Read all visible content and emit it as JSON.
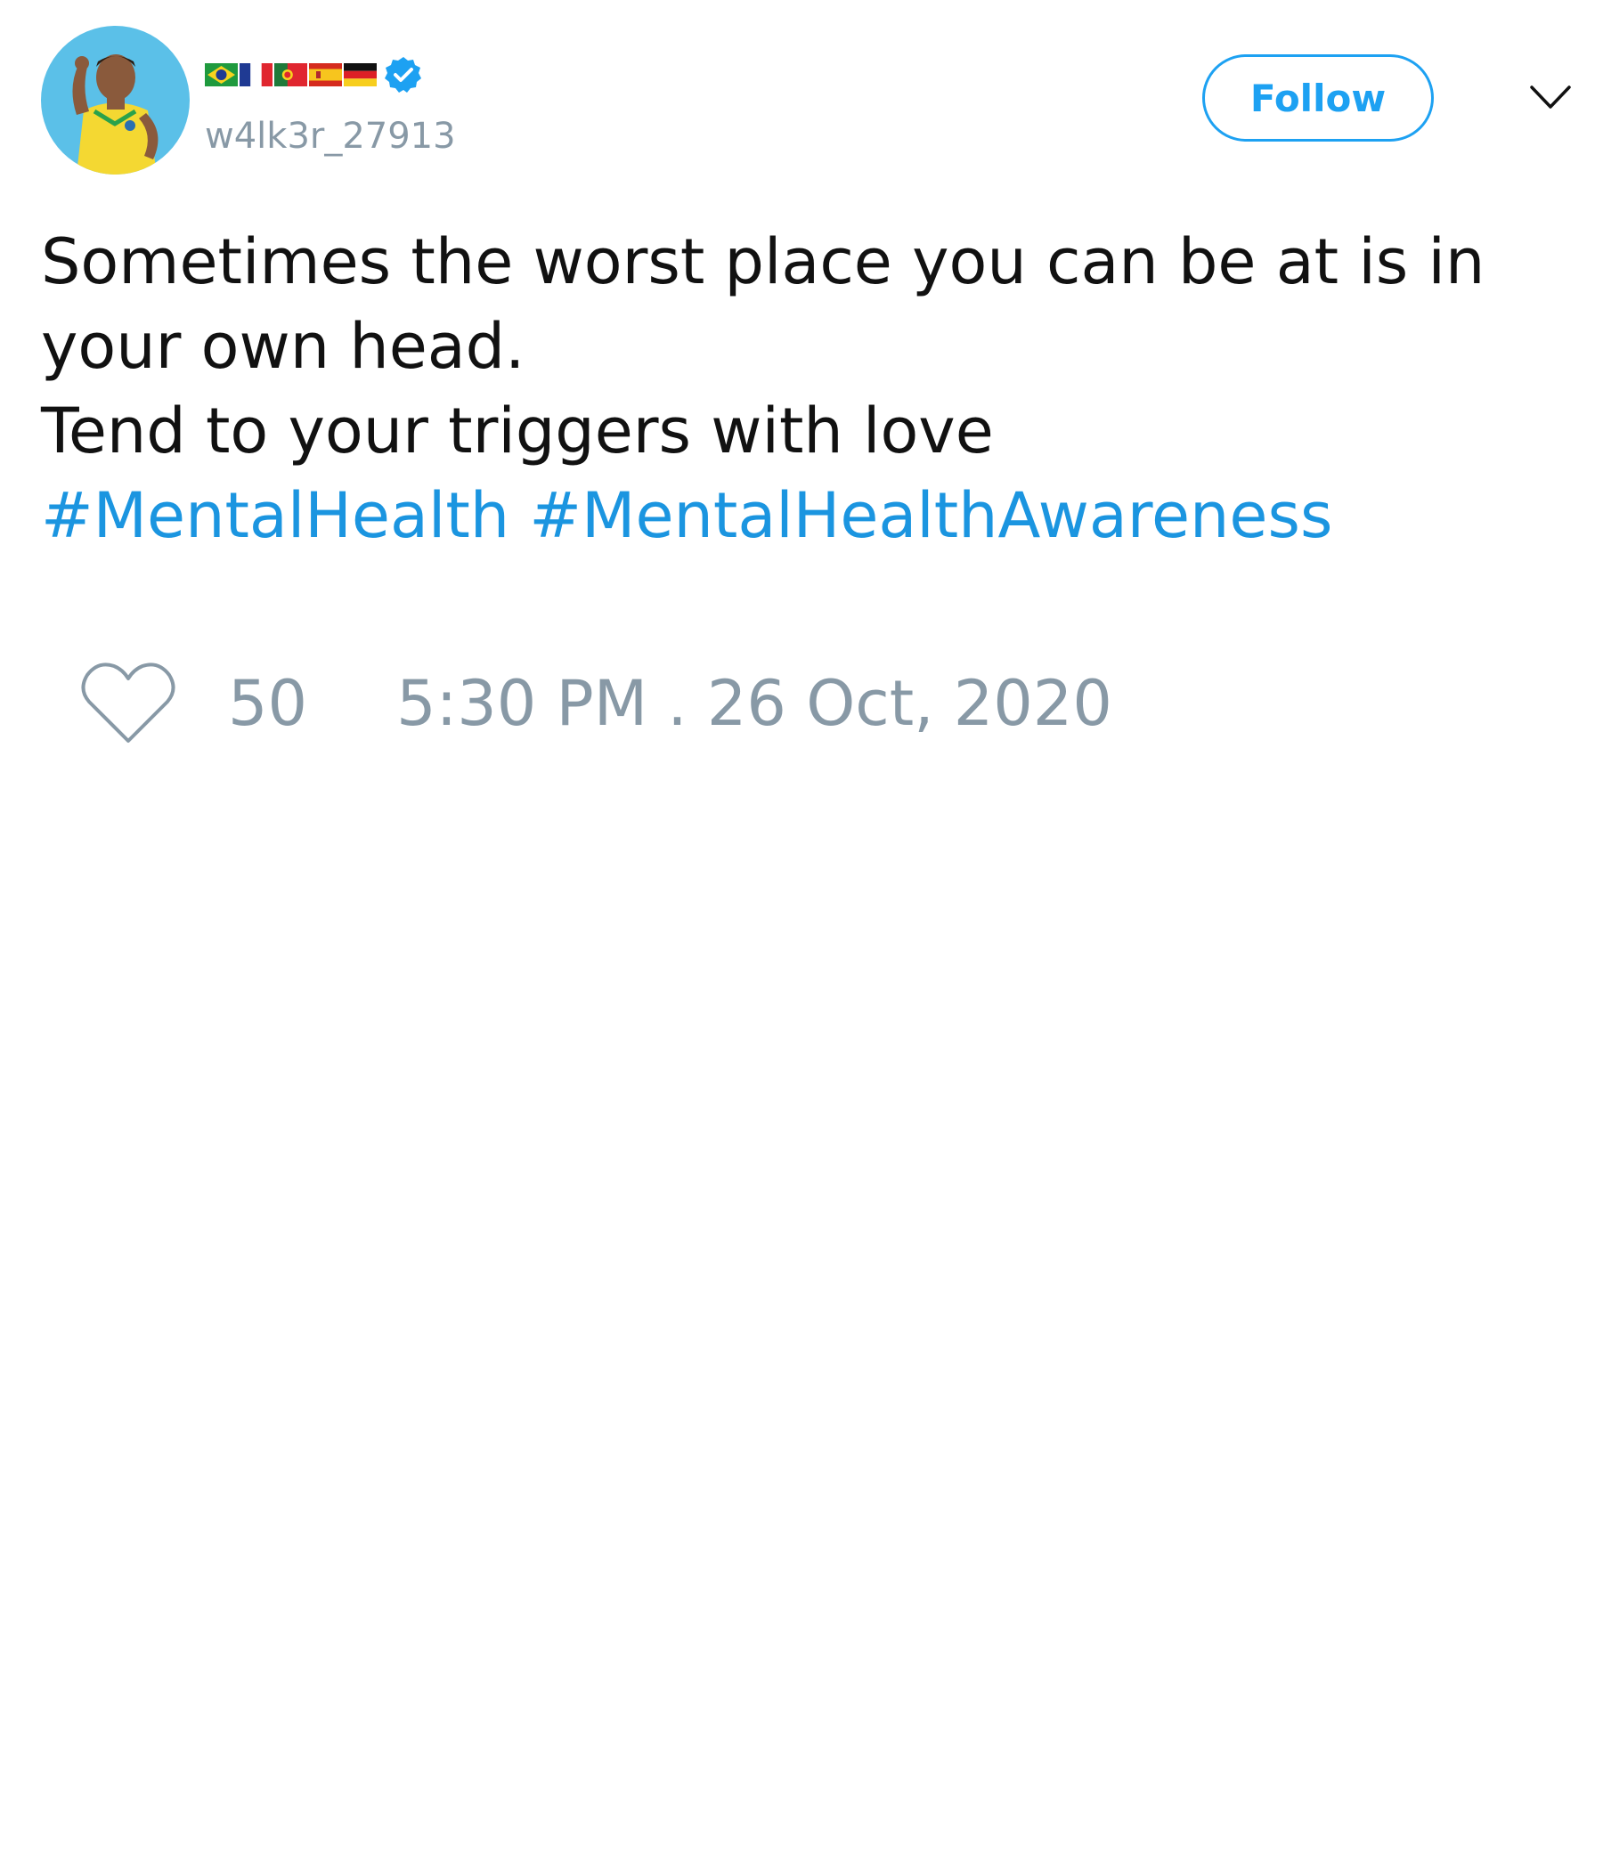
{
  "user": {
    "display_flags": [
      "brazil-flag",
      "france-flag",
      "portugal-flag",
      "spain-flag",
      "germany-flag"
    ],
    "verified": true,
    "handle": "w4lk3r_27913"
  },
  "header": {
    "follow_label": "Follow"
  },
  "tweet": {
    "line1": "Sometimes the worst place you can be at is in",
    "line2": "your own head.",
    "line3": "Tend to your triggers with love",
    "hashtags": [
      "#MentalHealth",
      "#MentalHealthAwareness"
    ]
  },
  "footer": {
    "like_count": "50",
    "timestamp": "5:30 PM . 26 Oct, 2020"
  },
  "colors": {
    "accent": "#1da1f2",
    "hashtag": "#1b95e0",
    "muted": "#8899a6",
    "text": "#111111"
  }
}
